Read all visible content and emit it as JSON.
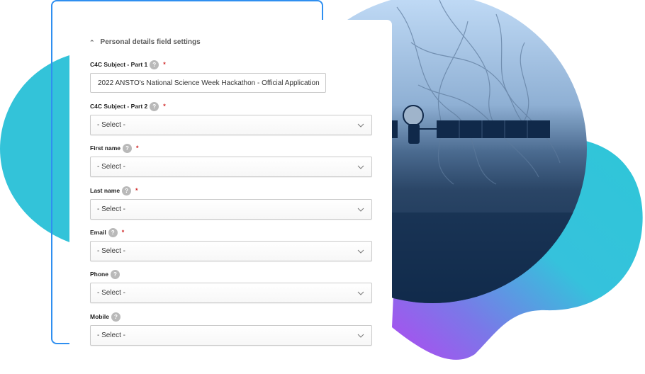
{
  "section": {
    "title": "Personal details field settings",
    "collapse_icon": "chevron-up-icon"
  },
  "fields": [
    {
      "label": "C4C Subject - Part 1",
      "help": "?",
      "required": "*",
      "type": "text",
      "value": "2022 ANSTO's National Science Week Hackathon - Official Application"
    },
    {
      "label": "C4C Subject - Part 2",
      "help": "?",
      "required": "*",
      "type": "select",
      "value": "- Select -"
    },
    {
      "label": "First name",
      "help": "?",
      "required": "*",
      "type": "select",
      "value": "- Select -"
    },
    {
      "label": "Last name",
      "help": "?",
      "required": "*",
      "type": "select",
      "value": "- Select -"
    },
    {
      "label": "Email",
      "help": "?",
      "required": "*",
      "type": "select",
      "value": "- Select -"
    },
    {
      "label": "Phone",
      "help": "?",
      "required": "",
      "type": "select",
      "value": "- Select -"
    },
    {
      "label": "Mobile",
      "help": "?",
      "required": "",
      "type": "select",
      "value": "- Select -"
    }
  ],
  "colors": {
    "frame_border": "#2f8ff0",
    "teal": "#33c3d9",
    "purple": "#a94df0",
    "navy": "#0f2a4a",
    "sky": "#b9d7f6",
    "required": "#d02828"
  }
}
